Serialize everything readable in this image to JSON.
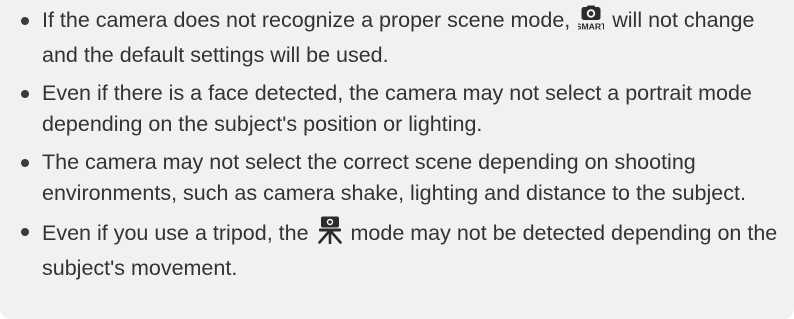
{
  "notes": [
    {
      "before": "If the camera does not recognize a proper scene mode,",
      "icon": "smart-auto-mode-icon",
      "after": "will not change and the default settings will be used."
    },
    {
      "text": "Even if there is a face detected, the camera may not select a portrait mode depending on the subject's position or lighting."
    },
    {
      "text": "The camera may not select the correct scene depending on shooting environments, such as camera shake, lighting and distance to the subject."
    },
    {
      "before": "Even if you use a tripod, the",
      "icon": "tripod-mode-icon",
      "after": "mode may not be detected depending on the subject's movement."
    }
  ],
  "icon_labels": {
    "smart_auto": "SMART"
  },
  "colors": {
    "panel_background": "#f1f1f1",
    "text": "#333333",
    "icon": "#2b2b2b"
  }
}
